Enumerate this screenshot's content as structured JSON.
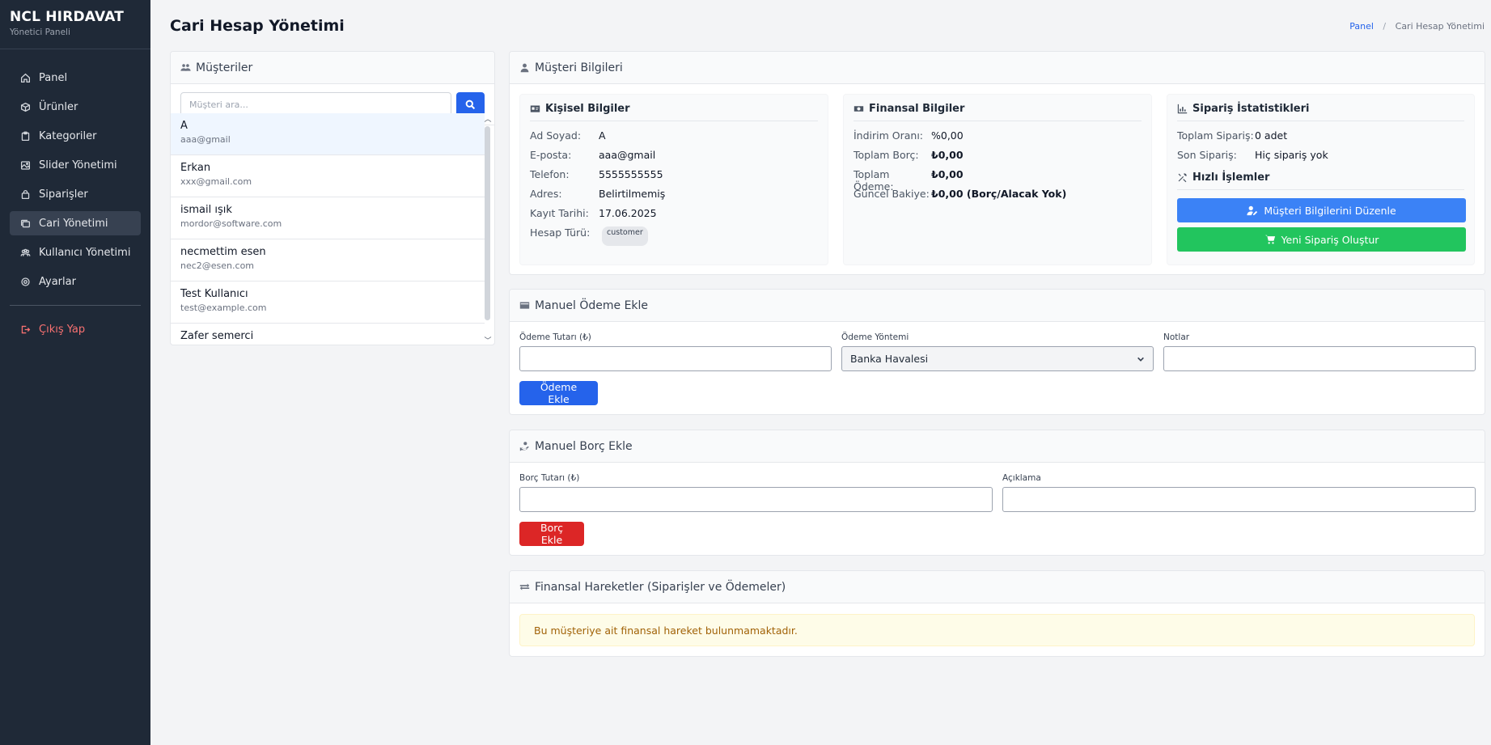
{
  "brand": {
    "title": "NCL HIRDAVAT",
    "subtitle": "Yönetici Paneli"
  },
  "sidebar": {
    "items": [
      {
        "label": "Panel",
        "icon": "home-icon"
      },
      {
        "label": "Ürünler",
        "icon": "box-icon"
      },
      {
        "label": "Kategoriler",
        "icon": "clipboard-icon"
      },
      {
        "label": "Slider Yönetimi",
        "icon": "image-icon"
      },
      {
        "label": "Siparişler",
        "icon": "bag-icon"
      },
      {
        "label": "Cari Yönetimi",
        "icon": "cards-icon",
        "active": true
      },
      {
        "label": "Kullanıcı Yönetimi",
        "icon": "users-icon"
      },
      {
        "label": "Ayarlar",
        "icon": "gear-icon"
      }
    ],
    "logout": "Çıkış Yap"
  },
  "header": {
    "title": "Cari Hesap Yönetimi",
    "breadcrumb": {
      "home": "Panel",
      "current": "Cari Hesap Yönetimi",
      "separator": "/"
    }
  },
  "customers": {
    "title": "Müşteriler",
    "search_placeholder": "Müşteri ara...",
    "list": [
      {
        "name": "A",
        "email": "aaa@gmail"
      },
      {
        "name": "Erkan",
        "email": "xxx@gmail.com"
      },
      {
        "name": "ismail ışık",
        "email": "mordor@software.com"
      },
      {
        "name": "necmettim esen",
        "email": "nec2@esen.com"
      },
      {
        "name": "Test Kullanıcı",
        "email": "test@example.com"
      },
      {
        "name": "Zafer semerci",
        "email": ""
      }
    ]
  },
  "customer_info": {
    "title": "Müşteri Bilgileri",
    "personal": {
      "title": "Kişisel Bilgiler",
      "rows": [
        {
          "k": "Ad Soyad:",
          "v": "A"
        },
        {
          "k": "E-posta:",
          "v": "aaa@gmail"
        },
        {
          "k": "Telefon:",
          "v": "5555555555"
        },
        {
          "k": "Adres:",
          "v": "Belirtilmemiş"
        },
        {
          "k": "Kayıt Tarihi:",
          "v": "17.06.2025"
        }
      ],
      "account_type_label": "Hesap Türü:",
      "account_type": "customer"
    },
    "financial": {
      "title": "Finansal Bilgiler",
      "discount_label": "İndirim Oranı:",
      "discount": "%0,00",
      "debt_label": "Toplam Borç:",
      "debt": "₺0,00",
      "paid_label": "Toplam Ödeme:",
      "paid": "₺0,00",
      "balance_label": "Güncel Bakiye:",
      "balance": "₺0,00 (Borç/Alacak Yok)"
    },
    "orders": {
      "title": "Sipariş İstatistikleri",
      "total_label": "Toplam Sipariş:",
      "total": "0 adet",
      "last_label": "Son Sipariş:",
      "last": "Hiç sipariş yok",
      "quick_title": "Hızlı İşlemler",
      "edit_button": "Müşteri Bilgilerini Düzenle",
      "new_order_button": "Yeni Sipariş Oluştur"
    }
  },
  "payment": {
    "title": "Manuel Ödeme Ekle",
    "amount_label": "Ödeme Tutarı (₺)",
    "method_label": "Ödeme Yöntemi",
    "method_value": "Banka Havalesi",
    "notes_label": "Notlar",
    "submit": "Ödeme Ekle"
  },
  "debt": {
    "title": "Manuel Borç Ekle",
    "amount_label": "Borç Tutarı (₺)",
    "desc_label": "Açıklama",
    "submit": "Borç Ekle"
  },
  "finance_moves": {
    "title": "Finansal Hareketler (Siparişler ve Ödemeler)",
    "empty": "Bu müşteriye ait finansal hareket bulunmamaktadır."
  }
}
